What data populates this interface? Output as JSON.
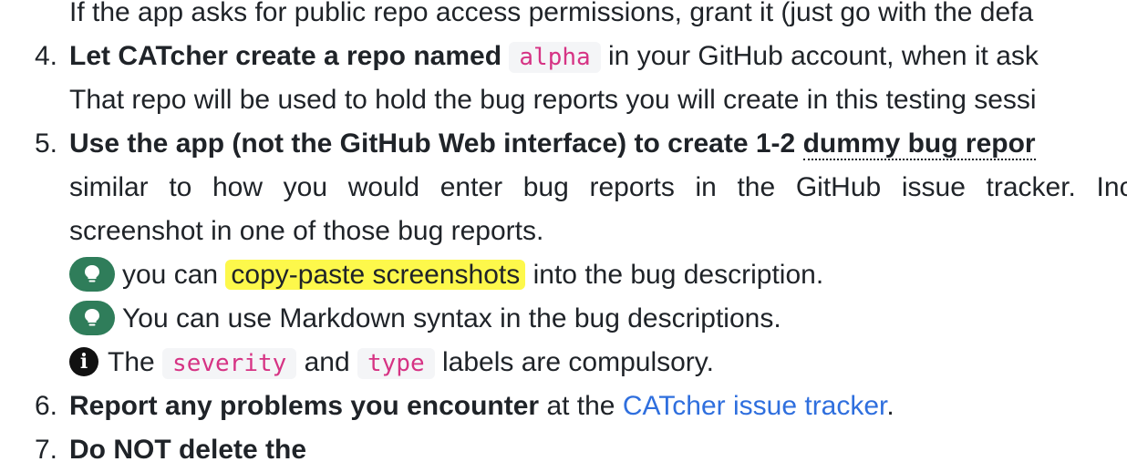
{
  "lines": {
    "l0": "If the app asks for public repo access permissions, grant it (just go with the defa",
    "item4": {
      "num": "4.",
      "bold": "Let CATcher create a repo named",
      "code": "alpha",
      "rest": "in your GitHub account, when it ask",
      "cont": "That repo will be used to hold the bug reports you will create in this testing sessi"
    },
    "item5": {
      "num": "5.",
      "bold": "Use the app (not the GitHub Web interface) to create 1-2",
      "bold_dotted": "dummy bug repor",
      "line2_words": [
        "similar",
        "to",
        "how",
        "you",
        "would",
        "enter",
        "bug",
        "reports",
        "in",
        "the",
        "GitHub",
        "issue",
        "tracker.",
        "Inclu"
      ],
      "line3": "screenshot in one of those bug reports.",
      "tip1_pre": "you can",
      "tip1_highlight": "copy-paste screenshots",
      "tip1_post": "into the bug description.",
      "tip2": "You can use Markdown syntax in the bug descriptions.",
      "info_pre": "The",
      "info_code1": "severity",
      "info_mid": "and",
      "info_code2": "type",
      "info_post": "labels are compulsory."
    },
    "item6": {
      "num": "6.",
      "bold": "Report any problems you encounter",
      "mid": "at the",
      "link": "CATcher issue tracker",
      "end": "."
    },
    "item7_partial": {
      "num": "7.",
      "text": "Do NOT delete the"
    }
  },
  "icons": {
    "tip": "lightbulb-icon",
    "info": "info-icon"
  },
  "colors": {
    "code_text": "#d63384",
    "highlight": "#fdf84b",
    "link": "#2f6fde",
    "tip_badge": "#2f7d5a"
  }
}
